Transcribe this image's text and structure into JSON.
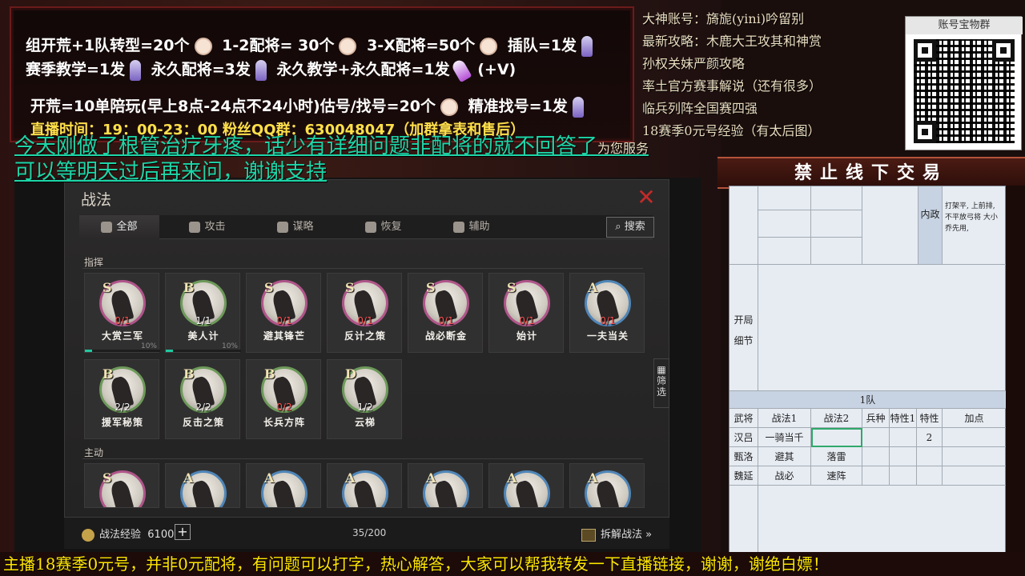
{
  "promo": {
    "line1": [
      "组开荒+1队转型=20个",
      "1-2配将= 30个",
      "3-X配将=50个",
      "插队=1发"
    ],
    "line2": [
      "赛季教学=1发",
      "永久配将=3发",
      "永久教学+永久配将=1发",
      "(+V)"
    ],
    "line3": [
      "开荒=10单陪玩(早上8点-24点不24小时)估号/找号=20个",
      "精准找号=1发"
    ],
    "line4": "直播时间：19：00-23：00   粉丝QQ群：630048047（加群拿表和售后）"
  },
  "overlay": {
    "line1": "今天刚做了根管治疗牙疼，话少有详细问题非配将的就不回答了",
    "line2": "可以等明天过后再来问，谢谢支持",
    "suffix": "为您服务"
  },
  "right_info": [
    "大神账号：旖旎(yini)吟留别",
    "最新攻略：木鹿大王攻其和神赏",
    "孙权关妹严颜攻略",
    "率土官方赛事解说（还有很多）",
    "临兵列阵全国赛四强",
    "18赛季0元号经验（有太后图）"
  ],
  "qr": {
    "title": "账号宝物群"
  },
  "banner": "禁止线下交易",
  "panel": {
    "title": "战法",
    "tabs": [
      {
        "label": "全部",
        "icon": "all-icon",
        "active": true
      },
      {
        "label": "攻击",
        "icon": "swords-icon"
      },
      {
        "label": "谋略",
        "icon": "strategy-icon"
      },
      {
        "label": "恢复",
        "icon": "heal-icon"
      },
      {
        "label": "辅助",
        "icon": "support-icon"
      }
    ],
    "search": "搜索",
    "section1": "指挥",
    "section2": "主动",
    "filter": "筛选",
    "cards_row1": [
      {
        "grade": "S",
        "count": "0/1",
        "red": true,
        "name": "大赏三军",
        "pct": "10%",
        "progress": 0.1,
        "tone": "s"
      },
      {
        "grade": "B",
        "count": "1/1",
        "red": false,
        "name": "美人计",
        "pct": "10%",
        "progress": 0.1,
        "tone": "g"
      },
      {
        "grade": "S",
        "count": "0/1",
        "red": true,
        "name": "避其锋芒",
        "tone": "s"
      },
      {
        "grade": "S",
        "count": "0/1",
        "red": true,
        "name": "反计之策",
        "tone": "s"
      },
      {
        "grade": "S",
        "count": "0/1",
        "red": true,
        "name": "战必断金",
        "tone": "s"
      },
      {
        "grade": "S",
        "count": "0/1",
        "red": true,
        "name": "始计",
        "tone": "s"
      },
      {
        "grade": "A",
        "count": "0/1",
        "red": true,
        "name": "一夫当关",
        "tone": "b"
      }
    ],
    "cards_row2": [
      {
        "grade": "B",
        "count": "2/2",
        "red": false,
        "name": "援军秘策",
        "tone": "g"
      },
      {
        "grade": "B",
        "count": "2/2",
        "red": false,
        "name": "反击之策",
        "tone": "g"
      },
      {
        "grade": "B",
        "count": "0/2",
        "red": true,
        "name": "长兵方阵",
        "tone": "g"
      },
      {
        "grade": "D",
        "count": "1/2",
        "red": false,
        "name": "云梯",
        "tone": "g"
      }
    ],
    "cards_row3": [
      {
        "grade": "S",
        "tone": "s"
      },
      {
        "grade": "A",
        "tone": "b"
      },
      {
        "grade": "A",
        "tone": "b"
      },
      {
        "grade": "A",
        "tone": "b"
      },
      {
        "grade": "A",
        "tone": "b"
      },
      {
        "grade": "A",
        "tone": "b"
      },
      {
        "grade": "A",
        "tone": "b"
      }
    ],
    "footer": {
      "exp_label": "战法经验",
      "exp_value": "6100",
      "capacity": "35/200",
      "decompose": "拆解战法 »"
    }
  },
  "sheet": {
    "neizheng": "内政",
    "note": "打架平, 上前排, 不平放弓将 大小乔先用,",
    "opening": "开局\n细节",
    "team": "1队",
    "headers": [
      "武将",
      "战法1",
      "战法2",
      "兵种",
      "特性1",
      "特性2",
      "加点"
    ],
    "rows": [
      [
        "汉吕",
        "一骑当千",
        "",
        "",
        "",
        "",
        ""
      ],
      [
        "甄洛",
        "避其",
        "落雷",
        "",
        "",
        "",
        ""
      ],
      [
        "魏延",
        "战必",
        "速阵",
        "",
        "",
        "",
        ""
      ]
    ]
  },
  "ticker": "主播18赛季0元号，并非0元配将，有问题可以打字，热心解答，大家可以帮我转发一下直播链接，谢谢，谢绝白嫖！"
}
